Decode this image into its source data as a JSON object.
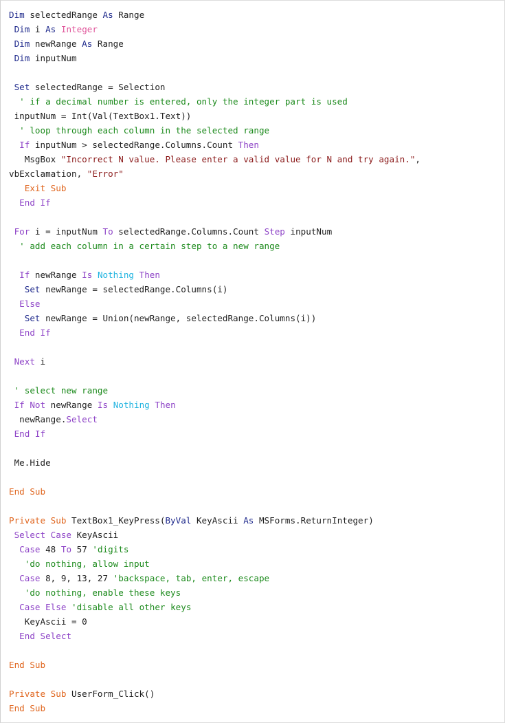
{
  "colors": {
    "background": "#ffffff",
    "border": "#dcdcdc",
    "plain": "#1f1f1f",
    "declaration_keyword": "#1f2a8c",
    "type_keyword": "#e0569b",
    "control_keyword": "#8e44c7",
    "nothing_keyword": "#1fb3e0",
    "sub_keyword": "#e0661f",
    "comment": "#1c8a1c",
    "string": "#8b1a1a"
  },
  "code": {
    "language": "VBA",
    "lines": [
      [
        [
          "dim",
          "Dim"
        ],
        [
          "plain",
          " selectedRange "
        ],
        [
          "dim",
          "As"
        ],
        [
          "plain",
          " Range"
        ]
      ],
      [
        [
          "plain",
          " "
        ],
        [
          "dim",
          "Dim"
        ],
        [
          "plain",
          " i "
        ],
        [
          "dim",
          "As"
        ],
        [
          "plain",
          " "
        ],
        [
          "type",
          "Integer"
        ]
      ],
      [
        [
          "plain",
          " "
        ],
        [
          "dim",
          "Dim"
        ],
        [
          "plain",
          " newRange "
        ],
        [
          "dim",
          "As"
        ],
        [
          "plain",
          " Range"
        ]
      ],
      [
        [
          "plain",
          " "
        ],
        [
          "dim",
          "Dim"
        ],
        [
          "plain",
          " inputNum"
        ]
      ],
      [],
      [
        [
          "plain",
          " "
        ],
        [
          "dim",
          "Set"
        ],
        [
          "plain",
          " selectedRange = Selection"
        ]
      ],
      [
        [
          "comment",
          "  ' if a decimal number is entered, only the integer part is used"
        ]
      ],
      [
        [
          "plain",
          " inputNum = Int(Val(TextBox1.Text))"
        ]
      ],
      [
        [
          "comment",
          "  ' loop through each column in the selected range"
        ]
      ],
      [
        [
          "plain",
          "  "
        ],
        [
          "ctrl",
          "If"
        ],
        [
          "plain",
          " inputNum > selectedRange.Columns.Count "
        ],
        [
          "ctrl",
          "Then"
        ]
      ],
      [
        [
          "plain",
          "   MsgBox "
        ],
        [
          "string",
          "\"Incorrect N value. Please enter a valid value for N and try again.\""
        ],
        [
          "plain",
          ","
        ]
      ],
      [
        [
          "plain",
          "vbExclamation, "
        ],
        [
          "string",
          "\"Error\""
        ]
      ],
      [
        [
          "plain",
          "   "
        ],
        [
          "sub",
          "Exit Sub"
        ]
      ],
      [
        [
          "plain",
          "  "
        ],
        [
          "ctrl",
          "End If"
        ]
      ],
      [],
      [
        [
          "plain",
          " "
        ],
        [
          "ctrl",
          "For"
        ],
        [
          "plain",
          " i = inputNum "
        ],
        [
          "ctrl",
          "To"
        ],
        [
          "plain",
          " selectedRange.Columns.Count "
        ],
        [
          "ctrl",
          "Step"
        ],
        [
          "plain",
          " inputNum"
        ]
      ],
      [
        [
          "comment",
          "  ' add each column in a certain step to a new range"
        ]
      ],
      [],
      [
        [
          "plain",
          "  "
        ],
        [
          "ctrl",
          "If"
        ],
        [
          "plain",
          " newRange "
        ],
        [
          "ctrl",
          "Is"
        ],
        [
          "plain",
          " "
        ],
        [
          "nothing",
          "Nothing"
        ],
        [
          "plain",
          " "
        ],
        [
          "ctrl",
          "Then"
        ]
      ],
      [
        [
          "plain",
          "   "
        ],
        [
          "dim",
          "Set"
        ],
        [
          "plain",
          " newRange = selectedRange.Columns(i)"
        ]
      ],
      [
        [
          "plain",
          "  "
        ],
        [
          "ctrl",
          "Else"
        ]
      ],
      [
        [
          "plain",
          "   "
        ],
        [
          "dim",
          "Set"
        ],
        [
          "plain",
          " newRange = Union(newRange, selectedRange.Columns(i))"
        ]
      ],
      [
        [
          "plain",
          "  "
        ],
        [
          "ctrl",
          "End If"
        ]
      ],
      [],
      [
        [
          "plain",
          " "
        ],
        [
          "ctrl",
          "Next"
        ],
        [
          "plain",
          " i"
        ]
      ],
      [],
      [
        [
          "comment",
          " ' select new range"
        ]
      ],
      [
        [
          "plain",
          " "
        ],
        [
          "ctrl",
          "If Not"
        ],
        [
          "plain",
          " newRange "
        ],
        [
          "ctrl",
          "Is"
        ],
        [
          "plain",
          " "
        ],
        [
          "nothing",
          "Nothing"
        ],
        [
          "plain",
          " "
        ],
        [
          "ctrl",
          "Then"
        ]
      ],
      [
        [
          "plain",
          "  newRange."
        ],
        [
          "ctrl",
          "Select"
        ]
      ],
      [
        [
          "plain",
          " "
        ],
        [
          "ctrl",
          "End If"
        ]
      ],
      [],
      [
        [
          "plain",
          " Me.Hide"
        ]
      ],
      [],
      [
        [
          "sub",
          "End Sub"
        ]
      ],
      [],
      [
        [
          "sub",
          "Private Sub"
        ],
        [
          "plain",
          " TextBox1_KeyPress("
        ],
        [
          "dim",
          "ByVal"
        ],
        [
          "plain",
          " KeyAscii "
        ],
        [
          "dim",
          "As"
        ],
        [
          "plain",
          " MSForms.ReturnInteger)"
        ]
      ],
      [
        [
          "plain",
          " "
        ],
        [
          "ctrl",
          "Select Case"
        ],
        [
          "plain",
          " KeyAscii"
        ]
      ],
      [
        [
          "plain",
          "  "
        ],
        [
          "ctrl",
          "Case"
        ],
        [
          "plain",
          " 48 "
        ],
        [
          "ctrl",
          "To"
        ],
        [
          "plain",
          " 57 "
        ],
        [
          "comment",
          "'digits"
        ]
      ],
      [
        [
          "comment",
          "   'do nothing, allow input"
        ]
      ],
      [
        [
          "plain",
          "  "
        ],
        [
          "ctrl",
          "Case"
        ],
        [
          "plain",
          " 8, 9, 13, 27 "
        ],
        [
          "comment",
          "'backspace, tab, enter, escape"
        ]
      ],
      [
        [
          "comment",
          "   'do nothing, enable these keys"
        ]
      ],
      [
        [
          "plain",
          "  "
        ],
        [
          "ctrl",
          "Case Else"
        ],
        [
          "plain",
          " "
        ],
        [
          "comment",
          "'disable all other keys"
        ]
      ],
      [
        [
          "plain",
          "   KeyAscii = 0"
        ]
      ],
      [
        [
          "plain",
          "  "
        ],
        [
          "ctrl",
          "End Select"
        ]
      ],
      [],
      [
        [
          "sub",
          "End Sub"
        ]
      ],
      [],
      [
        [
          "sub",
          "Private Sub"
        ],
        [
          "plain",
          " UserForm_Click()"
        ]
      ],
      [
        [
          "sub",
          "End Sub"
        ]
      ]
    ]
  }
}
